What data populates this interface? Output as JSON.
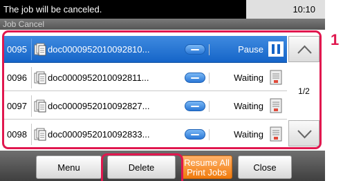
{
  "statusbar": {
    "message": "The job will be canceled.",
    "time": "10:10"
  },
  "header": {
    "title": "Job Cancel"
  },
  "jobs": [
    {
      "number": "0095",
      "filename": "doc0000952010092810...",
      "status": "Pause",
      "status_icon": "pause-icon",
      "selected": true
    },
    {
      "number": "0096",
      "filename": "doc0000952010092811...",
      "status": "Waiting",
      "status_icon": "document-waiting-icon",
      "selected": false
    },
    {
      "number": "0097",
      "filename": "doc0000952010092827...",
      "status": "Waiting",
      "status_icon": "document-waiting-icon",
      "selected": false
    },
    {
      "number": "0098",
      "filename": "doc0000952010092833...",
      "status": "Waiting",
      "status_icon": "document-waiting-icon",
      "selected": false
    }
  ],
  "pager": {
    "indicator": "1/2",
    "up_icon": "chevron-up-icon",
    "down_icon": "chevron-down-icon"
  },
  "callout": {
    "step": "1"
  },
  "bottom": {
    "menu": "Menu",
    "delete": "Delete",
    "resume_line1": "Resume All",
    "resume_line2": "Print Jobs",
    "close": "Close"
  },
  "colors": {
    "selected_row": "#1f6fd0",
    "highlight": "#e0174e",
    "resume_button": "#f5861f"
  }
}
